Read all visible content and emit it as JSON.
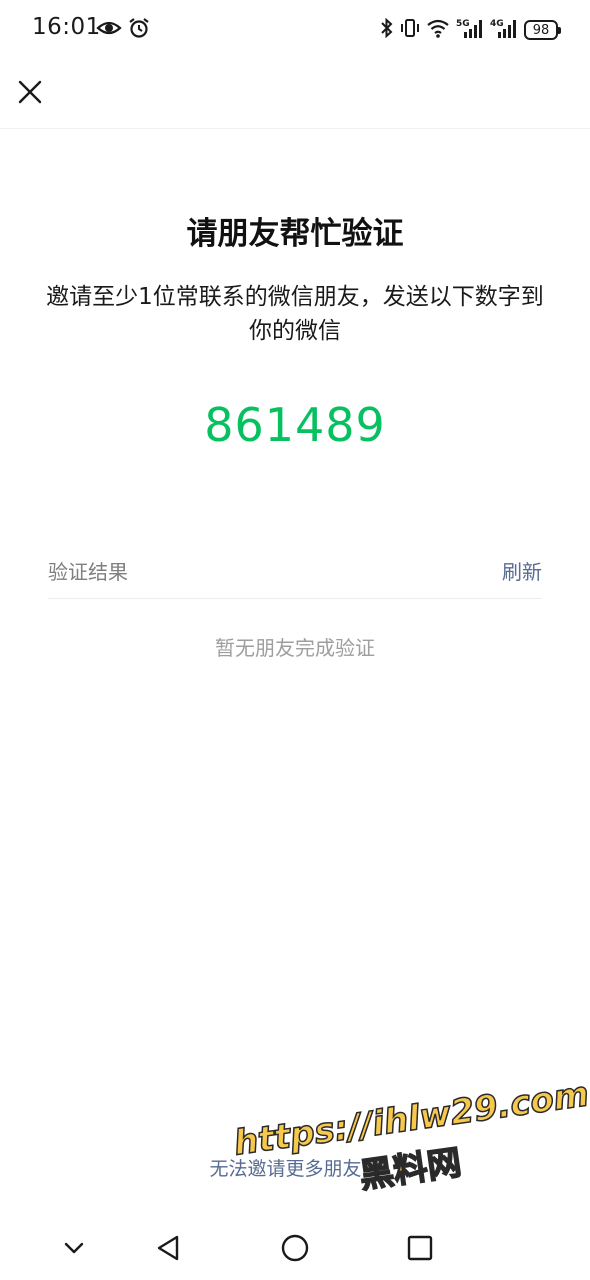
{
  "status_bar": {
    "time": "16:01",
    "battery": "98",
    "network_5g": "5G",
    "network_4g": "4G"
  },
  "nav": {
    "close_icon": "close-icon"
  },
  "main": {
    "title": "请朋友帮忙验证",
    "description": "邀请至少1位常联系的微信朋友，发送以下数字到你的微信",
    "code": "861489",
    "result_label": "验证结果",
    "refresh_label": "刷新",
    "empty_text": "暂无朋友完成验证",
    "bottom_link": "无法邀请更多朋友？"
  },
  "watermark": {
    "url": "https://ihlw29.com",
    "cn": "黑料网"
  },
  "colors": {
    "accent_green": "#07c160",
    "link_blue": "#576b95"
  }
}
